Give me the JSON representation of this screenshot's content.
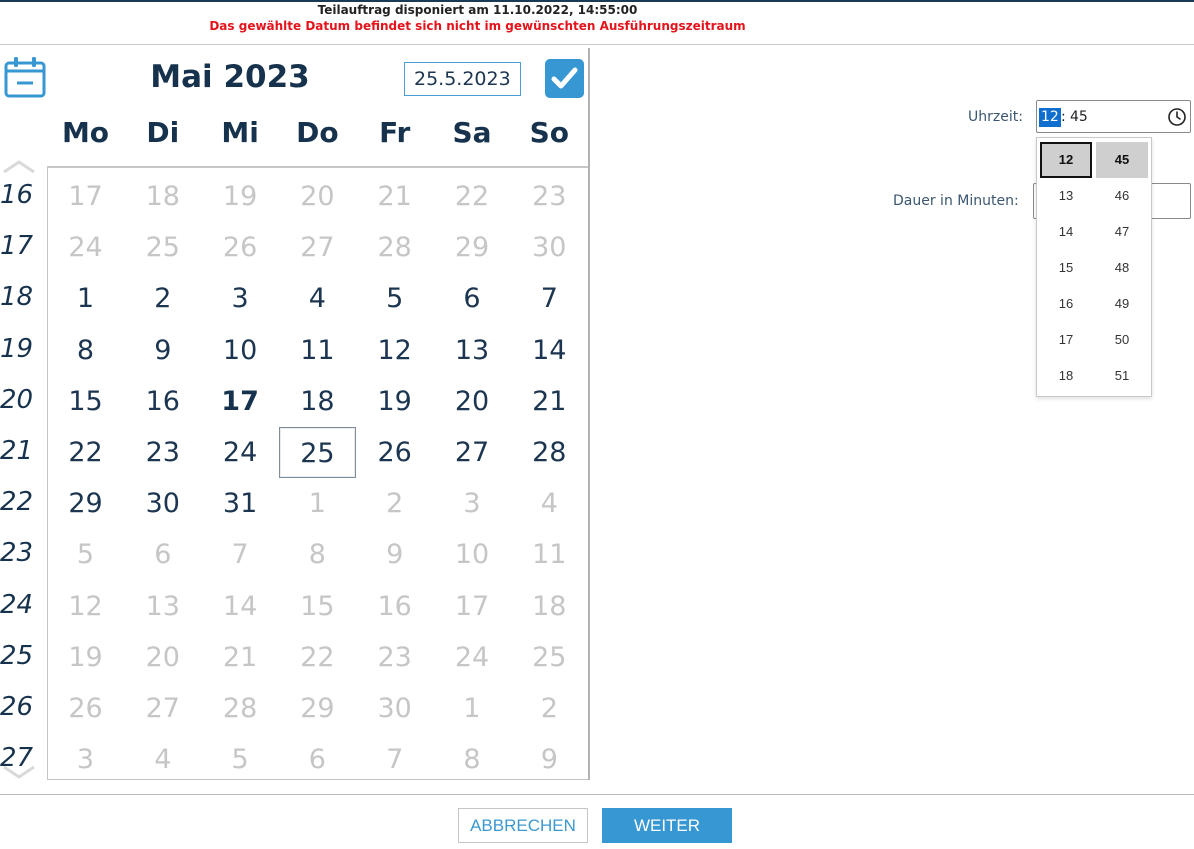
{
  "header": {
    "line1": "Teilauftrag disponiert am 11.10.2022, 14:55:00",
    "line2": "Das gewählte Datum befindet sich nicht im gewünschten Ausführungszeitraum",
    "line2_color": "#e3141b"
  },
  "calendar": {
    "icon": "calendar-icon",
    "month_title": "Mai 2023",
    "date_value": "25.5.2023",
    "confirm_icon": "checkmark-icon",
    "weekdays": [
      "Mo",
      "Di",
      "Mi",
      "Do",
      "Fr",
      "Sa",
      "So"
    ],
    "weeks": [
      "16",
      "17",
      "18",
      "19",
      "20",
      "21",
      "22",
      "23",
      "24",
      "25",
      "26",
      "27"
    ],
    "rows": [
      [
        "17",
        "18",
        "19",
        "20",
        "21",
        "22",
        "23"
      ],
      [
        "24",
        "25",
        "26",
        "27",
        "28",
        "29",
        "30"
      ],
      [
        "1",
        "2",
        "3",
        "4",
        "5",
        "6",
        "7"
      ],
      [
        "8",
        "9",
        "10",
        "11",
        "12",
        "13",
        "14"
      ],
      [
        "15",
        "16",
        "17",
        "18",
        "19",
        "20",
        "21"
      ],
      [
        "22",
        "23",
        "24",
        "25",
        "26",
        "27",
        "28"
      ],
      [
        "29",
        "30",
        "31",
        "1",
        "2",
        "3",
        "4"
      ],
      [
        "5",
        "6",
        "7",
        "8",
        "9",
        "10",
        "11"
      ],
      [
        "12",
        "13",
        "14",
        "15",
        "16",
        "17",
        "18"
      ],
      [
        "19",
        "20",
        "21",
        "22",
        "23",
        "24",
        "25"
      ],
      [
        "26",
        "27",
        "28",
        "29",
        "30",
        "1",
        "2"
      ],
      [
        "3",
        "4",
        "5",
        "6",
        "7",
        "8",
        "9"
      ]
    ],
    "today": "17",
    "selected": "25",
    "accent_color": "#3797d3"
  },
  "time": {
    "label": "Uhrzeit:",
    "hour": "12",
    "separator": ":",
    "minute": "45",
    "icon": "clock-icon",
    "hours_list": [
      "12",
      "13",
      "14",
      "15",
      "16",
      "17",
      "18"
    ],
    "minutes_list": [
      "45",
      "46",
      "47",
      "48",
      "49",
      "50",
      "51"
    ]
  },
  "duration": {
    "label": "Dauer in Minuten:",
    "value": ""
  },
  "footer": {
    "cancel_label": "ABBRECHEN",
    "next_label": "WEITER"
  }
}
